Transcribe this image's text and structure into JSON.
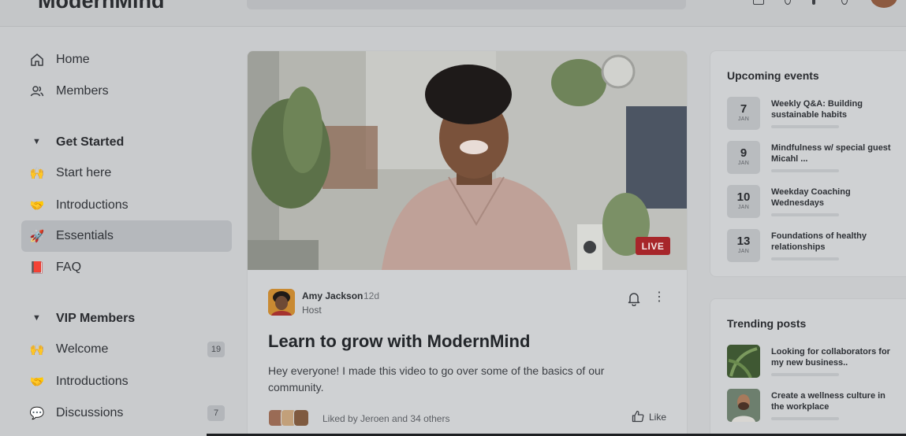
{
  "header": {
    "logo": "ModernMind"
  },
  "sidebar": {
    "items": [
      {
        "label": "Home",
        "icon": "home-icon"
      },
      {
        "label": "Members",
        "icon": "members-icon"
      }
    ],
    "sections": [
      {
        "title": "Get Started",
        "items": [
          {
            "label": "Start here",
            "icon": "🙌"
          },
          {
            "label": "Introductions",
            "icon": "🤝"
          },
          {
            "label": "Essentials",
            "icon": "🚀",
            "active": true
          },
          {
            "label": "FAQ",
            "icon": "📕"
          }
        ]
      },
      {
        "title": "VIP Members",
        "items": [
          {
            "label": "Welcome",
            "icon": "🙌",
            "count": "19"
          },
          {
            "label": "Introductions",
            "icon": "🤝"
          },
          {
            "label": "Discussions",
            "icon": "💬",
            "count": "7"
          }
        ]
      }
    ]
  },
  "post": {
    "live_badge": "LIVE",
    "author": "Amy Jackson",
    "age": "12d",
    "role": "Host",
    "title": "Learn to grow with ModernMind",
    "body": "Hey everyone! I made this video to go over some of the basics of our community.",
    "liked_by": "Liked by Jeroen and 34 others",
    "like_label": "Like"
  },
  "events": {
    "title": "Upcoming events",
    "items": [
      {
        "day": "7",
        "month": "JAN",
        "title": "Weekly Q&A: Building sustainable habits"
      },
      {
        "day": "9",
        "month": "JAN",
        "title": "Mindfulness w/ special guest Micahl ..."
      },
      {
        "day": "10",
        "month": "JAN",
        "title": "Weekday Coaching Wednesdays"
      },
      {
        "day": "13",
        "month": "JAN",
        "title": "Foundations of healthy relationships"
      }
    ]
  },
  "trending": {
    "title": "Trending posts",
    "items": [
      {
        "title": "Looking for collaborators for my new business.."
      },
      {
        "title": "Create a wellness culture in the workplace"
      }
    ]
  },
  "colors": {
    "overlay_bg": "#c9cbcd",
    "live_red": "#a7262a",
    "active_item": "#b5b8bc"
  }
}
